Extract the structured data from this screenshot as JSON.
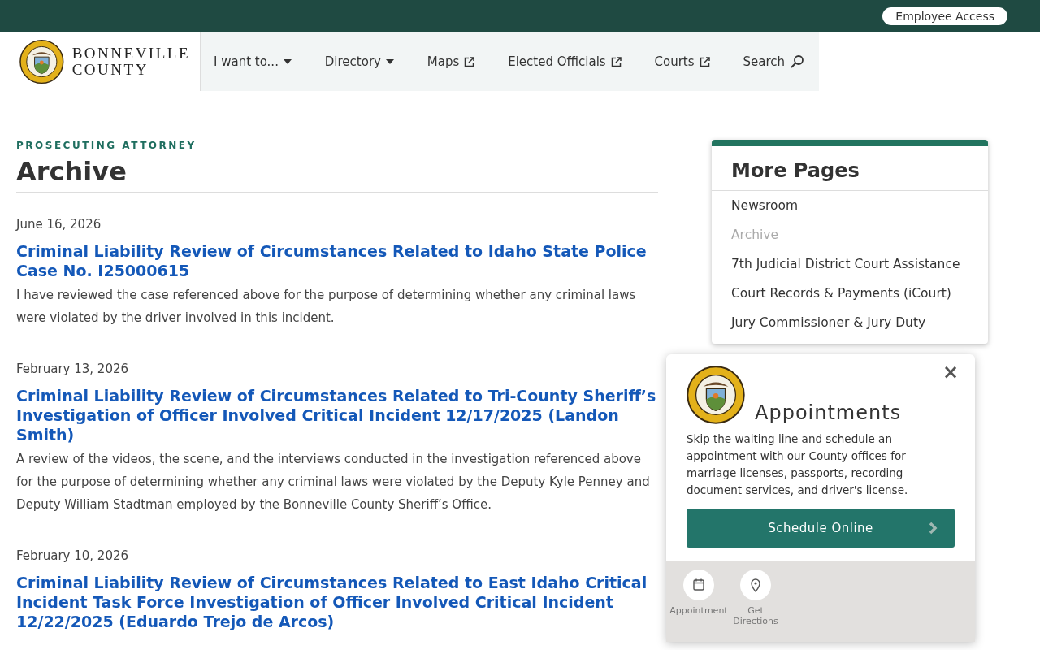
{
  "top_bar": {
    "employee_access": "Employee Access"
  },
  "header": {
    "logo_line1": "BONNEVILLE",
    "logo_line2": "COUNTY",
    "nav": [
      {
        "label": "I want to...",
        "kind": "dropdown"
      },
      {
        "label": "Directory",
        "kind": "dropdown"
      },
      {
        "label": "Maps",
        "kind": "external"
      },
      {
        "label": "Elected Officials",
        "kind": "external"
      },
      {
        "label": "Courts",
        "kind": "external"
      },
      {
        "label": "Search",
        "kind": "search"
      }
    ]
  },
  "page": {
    "section": "PROSECUTING ATTORNEY",
    "title": "Archive",
    "articles": [
      {
        "date": "June 16, 2026",
        "title": "Criminal Liability Review of Circumstances Related to Idaho State Police Case No. I25000615",
        "summary": "I have reviewed the case referenced above for the purpose of determining whether any criminal laws were violated by the driver involved in this incident."
      },
      {
        "date": "February 13, 2026",
        "title": "Criminal Liability Review of Circumstances Related to Tri-County Sheriff’s Investigation of Officer Involved Critical Incident 12/17/2025 (Landon Smith)",
        "summary": "A review of the videos, the scene, and the interviews conducted in the investigation referenced above for the purpose of determining whether any criminal laws were violated by the Deputy Kyle Penney and Deputy William Stadtman employed by the Bonneville County Sheriff’s Office."
      },
      {
        "date": "February 10, 2026",
        "title": "Criminal Liability Review of Circumstances Related to East Idaho Critical Incident Task Force Investigation of Officer Involved Critical Incident 12/22/2025 (Eduardo Trejo de Arcos)"
      }
    ]
  },
  "sidebar": {
    "title": "More Pages",
    "items": [
      {
        "label": "Newsroom",
        "selected": false
      },
      {
        "label": "Archive",
        "selected": true
      },
      {
        "label": "7th Judicial District Court Assistance",
        "selected": false
      },
      {
        "label": "Court Records & Payments (iCourt)",
        "selected": false
      },
      {
        "label": "Jury Commissioner & Jury Duty",
        "selected": false
      }
    ]
  },
  "popup": {
    "title": "Appointments",
    "close": "×",
    "text": "Skip the waiting line and schedule an appointment with our County offices for marriage licenses, passports, recording document services, and driver's license.",
    "button": "Schedule Online",
    "actions": [
      {
        "label": "Appointment",
        "kind": "calendar"
      },
      {
        "label": "Get Directions",
        "kind": "pin"
      }
    ]
  }
}
